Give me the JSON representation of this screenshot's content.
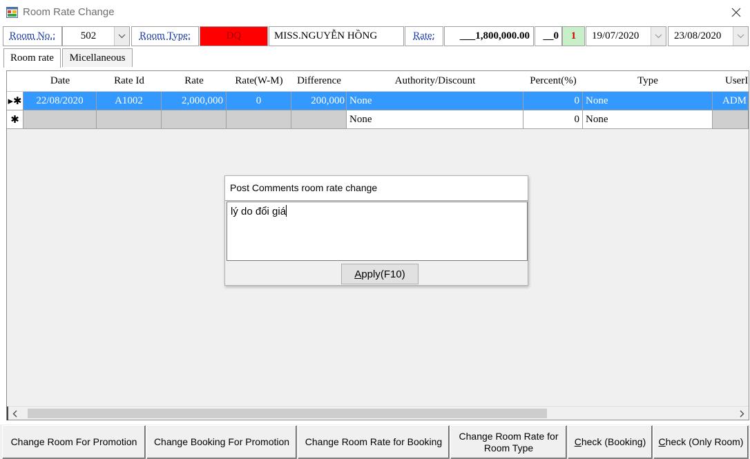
{
  "window": {
    "title": "Room Rate Change",
    "icon": "app-window-icon",
    "close_icon": "close-icon"
  },
  "header": {
    "room_no_label": "Room No.:",
    "room_no_value": "502",
    "room_type_label": "Room Type:",
    "room_type_value": "DQ",
    "room_type_color": "#ff0000",
    "guest_name": "MISS.NGUYỄN HỒNG",
    "rate_label": "Rate:",
    "rate_value": "___1,800,000.00",
    "count_value": "__0",
    "nights_value": "1",
    "nights_color": "#c8f0c8",
    "arrival_date": "19/07/2020",
    "departure_date": "23/08/2020"
  },
  "tabs": [
    {
      "label": "Room rate",
      "active": true
    },
    {
      "label": "Micellaneous",
      "active": false
    }
  ],
  "grid": {
    "columns": [
      "Date",
      "Rate Id",
      "Rate",
      "Rate(W-M)",
      "Difference",
      "Authority/Discount",
      "Percent(%)",
      "Type",
      "UserI"
    ],
    "rows": [
      {
        "marker": "▸✱",
        "date": "22/08/2020",
        "rate_id": "A1002",
        "rate": "2,000,000",
        "rate_wm": "0",
        "difference": "200,000",
        "authority": "None",
        "percent": "0",
        "type": "None",
        "user": "ADM",
        "selected": true
      },
      {
        "marker": "✱",
        "date": "",
        "rate_id": "",
        "rate": "",
        "rate_wm": "",
        "difference": "",
        "authority": "None",
        "percent": "0",
        "type": "None",
        "user": "",
        "selected": false
      }
    ],
    "selection_color": "#3399ff"
  },
  "popup": {
    "title": "Post Comments room rate change",
    "comment": "lý do đổi giá",
    "apply_label": "Apply(F10)",
    "apply_mnemonic": "A"
  },
  "buttons": [
    {
      "label": "Change Room For Promotion"
    },
    {
      "label": "Change Booking For Promotion"
    },
    {
      "label": "Change Room Rate for Booking"
    },
    {
      "label": "Change Room Rate for Room Type"
    },
    {
      "label": "Check (Booking)"
    },
    {
      "label": "Check (Only Room)"
    }
  ]
}
